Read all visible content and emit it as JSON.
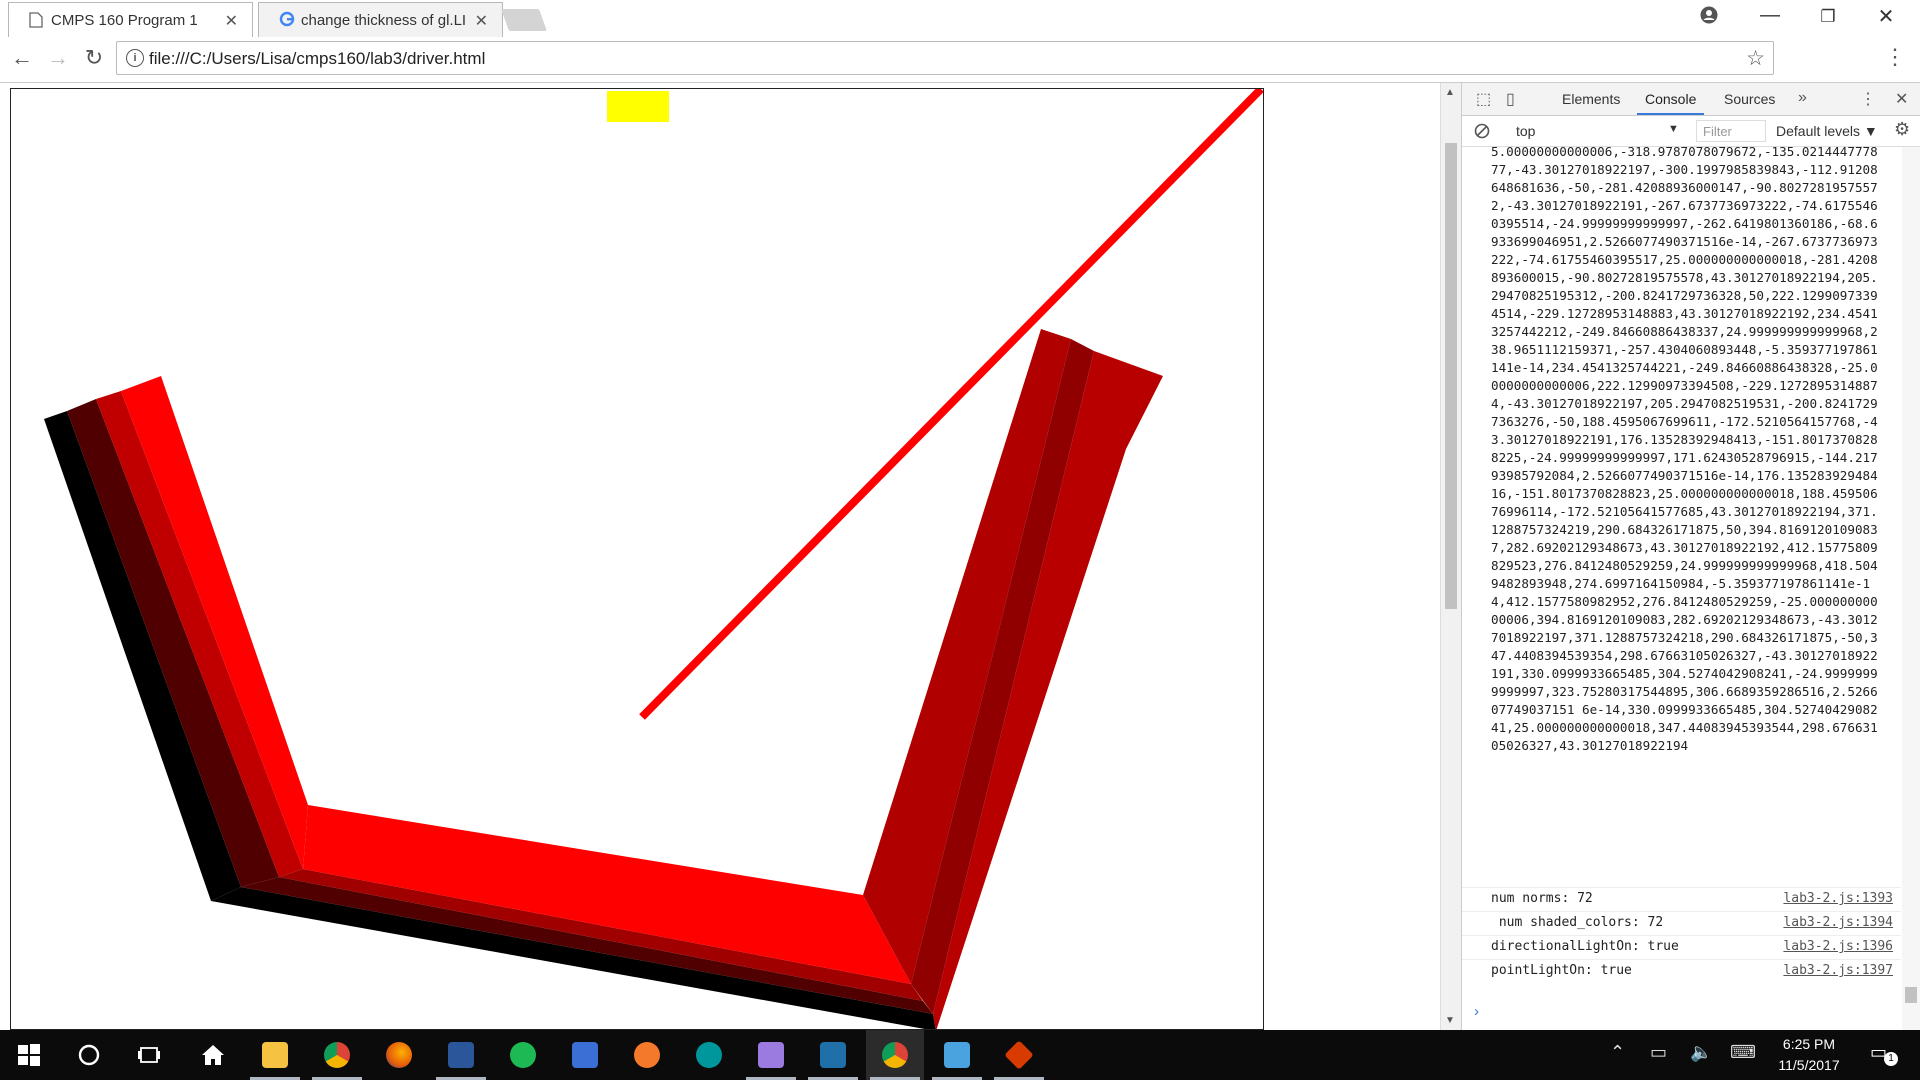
{
  "browser": {
    "tabs": [
      {
        "title": "CMPS 160 Program 1",
        "active": true
      },
      {
        "title": "change thickness of gl.LI",
        "active": false
      }
    ],
    "url": "file:///C:/Users/Lisa/cmps160/lab3/driver.html"
  },
  "devtools": {
    "tabs": [
      "Elements",
      "Console",
      "Sources"
    ],
    "active_tab": "Console",
    "context": "top",
    "filter_placeholder": "Filter",
    "levels": "Default levels",
    "console_dump": "5.00000000000006,-318.9787078079672,-135.021444777877,-43.30127018922197,-300.1997985839843,-112.91208648681636,-50,-281.42088936000147,-90.80272819575572,-43.30127018922191,-267.6737736973222,-74.61755460395514,-24.99999999999997,-262.6419801360186,-68.6933699046951,2.5266077490371516e-14,-267.6737736973222,-74.61755460395517,25.000000000000018,-281.4208893600015,-90.80272819575578,43.30127018922194,205.29470825195312,-200.8241729736328,50,222.12990973394514,-229.12728953148883,43.30127018922192,234.45413257442212,-249.84660886438337,24.999999999999968,238.9651112159371,-257.4304060893448,-5.359377197861141e-14,234.4541325744221,-249.84660886438328,-25.00000000000006,222.12990973394508,-229.12728953148874,-43.30127018922197,205.2947082519531,-200.82417297363276,-50,188.4595067699611,-172.5210564157768,-43.30127018922191,176.13528392948413,-151.80173708288225,-24.99999999999997,171.62430528796915,-144.21793985792084,2.5266077490371516e-14,176.13528392948416,-151.8017370828823,25.000000000000018,188.45950676996114,-172.52105641577685,43.30127018922194,371.1288757324219,290.684326171875,50,394.81691201090837,282.69202129348673,43.30127018922192,412.15775809829523,276.8412480529259,24.999999999999968,418.5049482893948,274.6997164150984,-5.359377197861141e-14,412.1577580982952,276.8412480529259,-25.00000000000006,394.8169120109083,282.69202129348673,-43.30127018922197,371.1288757324218,290.684326171875,-50,347.4408394539354,298.67663105026327,-43.30127018922191,330.0999933665485,304.5274042908241,-24.99999999999997,323.75280317544895,306.6689359286516,2.526607749037151 6e-14,330.0999933665485,304.5274042908241,25.000000000000018,347.44083945393544,298.67663105026327,43.30127018922194",
    "logs": [
      {
        "msg": "num norms: 72",
        "src": "lab3-2.js:1393"
      },
      {
        "msg": " num shaded_colors: 72",
        "src": "lab3-2.js:1394"
      },
      {
        "msg": "directionalLightOn: true",
        "src": "lab3-2.js:1396"
      },
      {
        "msg": "pointLightOn: true",
        "src": "lab3-2.js:1397"
      }
    ]
  },
  "taskbar": {
    "time": "6:25 PM",
    "date": "11/5/2017",
    "notifications": "1"
  },
  "colors": {
    "square": "#ffff00",
    "line": "#ff0000"
  }
}
